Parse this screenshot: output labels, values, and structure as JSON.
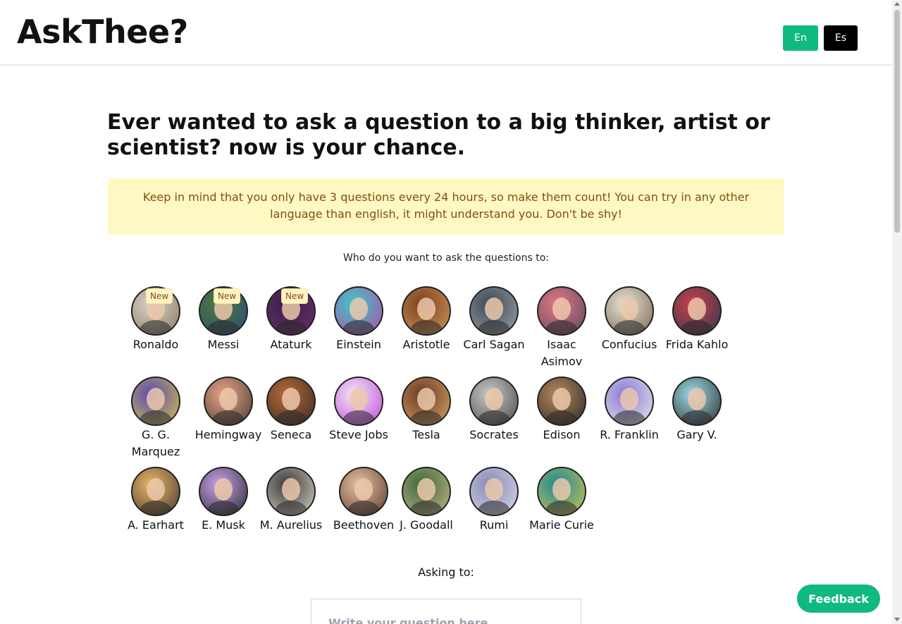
{
  "header": {
    "logo": "AskThee?",
    "lang_en": "En",
    "lang_es": "Es"
  },
  "main": {
    "headline": "Ever wanted to ask a question to a big thinker, artist or scientist? now is your chance.",
    "notice": "Keep in mind that you only have 3 questions every 24 hours, so make them count!  You can try in any other language than english, it might understand you. Don't be shy!",
    "who_label": "Who do you want to ask the questions to:",
    "badge_label": "New",
    "asking_label": "Asking to:",
    "question_placeholder": "Write your question here"
  },
  "thinkers": [
    {
      "name": "Ronaldo",
      "is_new": true,
      "colors": [
        "#d9d4c7",
        "#8a7a64"
      ]
    },
    {
      "name": "Messi",
      "is_new": true,
      "colors": [
        "#4f7a3a",
        "#2b4a7a"
      ]
    },
    {
      "name": "Ataturk",
      "is_new": true,
      "colors": [
        "#3a1f4a",
        "#6a2f6a"
      ]
    },
    {
      "name": "Einstein",
      "is_new": false,
      "colors": [
        "#3ec9c9",
        "#b24aa8"
      ]
    },
    {
      "name": "Aristotle",
      "is_new": false,
      "colors": [
        "#7a3f1f",
        "#d19a5a"
      ]
    },
    {
      "name": "Carl Sagan",
      "is_new": false,
      "colors": [
        "#3f4a55",
        "#9aa2a8"
      ]
    },
    {
      "name": "Isaac Asimov",
      "is_new": false,
      "colors": [
        "#e2788a",
        "#5a4a55"
      ]
    },
    {
      "name": "Confucius",
      "is_new": false,
      "colors": [
        "#e8e2d8",
        "#7a6a4f"
      ]
    },
    {
      "name": "Frida Kahlo",
      "is_new": false,
      "colors": [
        "#c93f4a",
        "#2f3a4f"
      ]
    },
    {
      "name": "G. G. Marquez",
      "is_new": false,
      "colors": [
        "#5a4ab2",
        "#d8c24a"
      ]
    },
    {
      "name": "Hemingway",
      "is_new": false,
      "colors": [
        "#e8a58a",
        "#4a3a35"
      ]
    },
    {
      "name": "Seneca",
      "is_new": false,
      "colors": [
        "#b56a3a",
        "#3a2a22"
      ]
    },
    {
      "name": "Steve Jobs",
      "is_new": false,
      "colors": [
        "#f0e8f5",
        "#c24ad8"
      ]
    },
    {
      "name": "Tesla",
      "is_new": false,
      "colors": [
        "#6a3a22",
        "#d8a56a"
      ]
    },
    {
      "name": "Socrates",
      "is_new": false,
      "colors": [
        "#c8c8c8",
        "#4a4a4a"
      ]
    },
    {
      "name": "Edison",
      "is_new": false,
      "colors": [
        "#b58a5a",
        "#2a2a2a"
      ]
    },
    {
      "name": "R. Franklin",
      "is_new": false,
      "colors": [
        "#8a7ad8",
        "#e8e8e8"
      ]
    },
    {
      "name": "Gary V.",
      "is_new": false,
      "colors": [
        "#9adbe8",
        "#2f2f2f"
      ]
    },
    {
      "name": "A. Earhart",
      "is_new": false,
      "colors": [
        "#e8b56a",
        "#4a3a2a"
      ]
    },
    {
      "name": "E. Musk",
      "is_new": false,
      "colors": [
        "#c8a2e8",
        "#2a2a35"
      ]
    },
    {
      "name": "M. Aurelius",
      "is_new": false,
      "colors": [
        "#3a3a3a",
        "#d8d2c8"
      ]
    },
    {
      "name": "Beethoven",
      "is_new": false,
      "colors": [
        "#e8c2a2",
        "#5a3a2a"
      ]
    },
    {
      "name": "J. Goodall",
      "is_new": false,
      "colors": [
        "#3a6a3a",
        "#c8b58a"
      ]
    },
    {
      "name": "Rumi",
      "is_new": false,
      "colors": [
        "#8a8ab5",
        "#d8d8e8"
      ]
    },
    {
      "name": "Marie Curie",
      "is_new": false,
      "colors": [
        "#1a8a9a",
        "#d8c24a"
      ]
    }
  ],
  "feedback_label": "Feedback",
  "colors": {
    "accent": "#10b981",
    "lang_es_bg": "#000000",
    "notice_bg": "#fef9c3",
    "notice_text": "#854d0e"
  }
}
